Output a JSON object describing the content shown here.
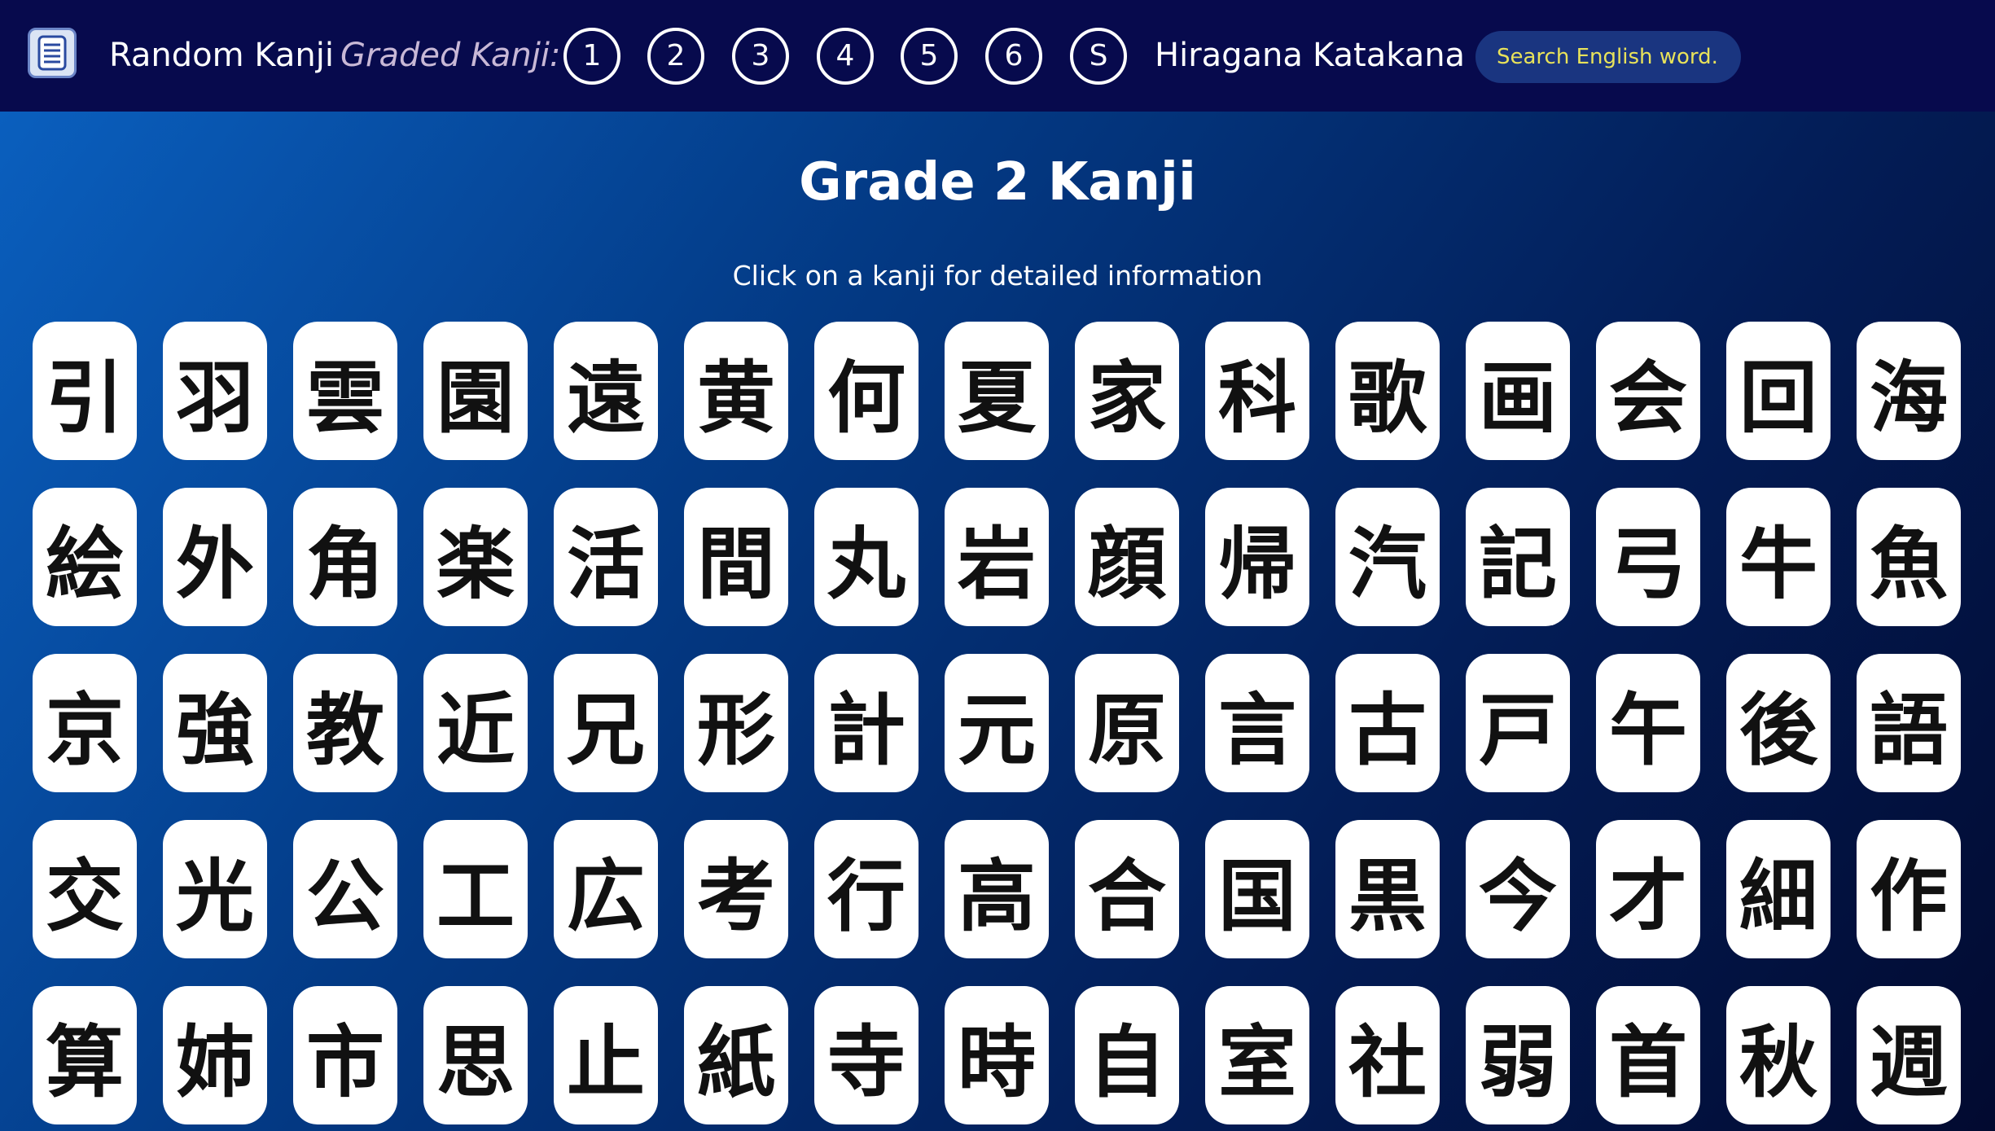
{
  "navbar": {
    "logo_icon": "scroll-document-icon",
    "random_kanji": "Random Kanji",
    "graded_label": "Graded Kanji:",
    "grades": [
      "1",
      "2",
      "3",
      "4",
      "5",
      "6",
      "S"
    ],
    "hiragana": "Hiragana",
    "katakana": "Katakana",
    "search_placeholder": "Search English word..."
  },
  "colors": {
    "navbar_bg": "#070a4d",
    "search_text": "#e8e25a",
    "card_bg": "#ffffff",
    "gradient_start": "#0a5fbe",
    "gradient_end": "#020a30"
  },
  "main": {
    "title": "Grade 2 Kanji",
    "subtitle": "Click on a kanji for detailed information",
    "kanji": [
      "引",
      "羽",
      "雲",
      "園",
      "遠",
      "黄",
      "何",
      "夏",
      "家",
      "科",
      "歌",
      "画",
      "会",
      "回",
      "海",
      "絵",
      "外",
      "角",
      "楽",
      "活",
      "間",
      "丸",
      "岩",
      "顔",
      "帰",
      "汽",
      "記",
      "弓",
      "牛",
      "魚",
      "京",
      "強",
      "教",
      "近",
      "兄",
      "形",
      "計",
      "元",
      "原",
      "言",
      "古",
      "戸",
      "午",
      "後",
      "語",
      "交",
      "光",
      "公",
      "工",
      "広",
      "考",
      "行",
      "高",
      "合",
      "国",
      "黒",
      "今",
      "才",
      "細",
      "作",
      "算",
      "姉",
      "市",
      "思",
      "止",
      "紙",
      "寺",
      "時",
      "自",
      "室",
      "社",
      "弱",
      "首",
      "秋",
      "週"
    ]
  }
}
